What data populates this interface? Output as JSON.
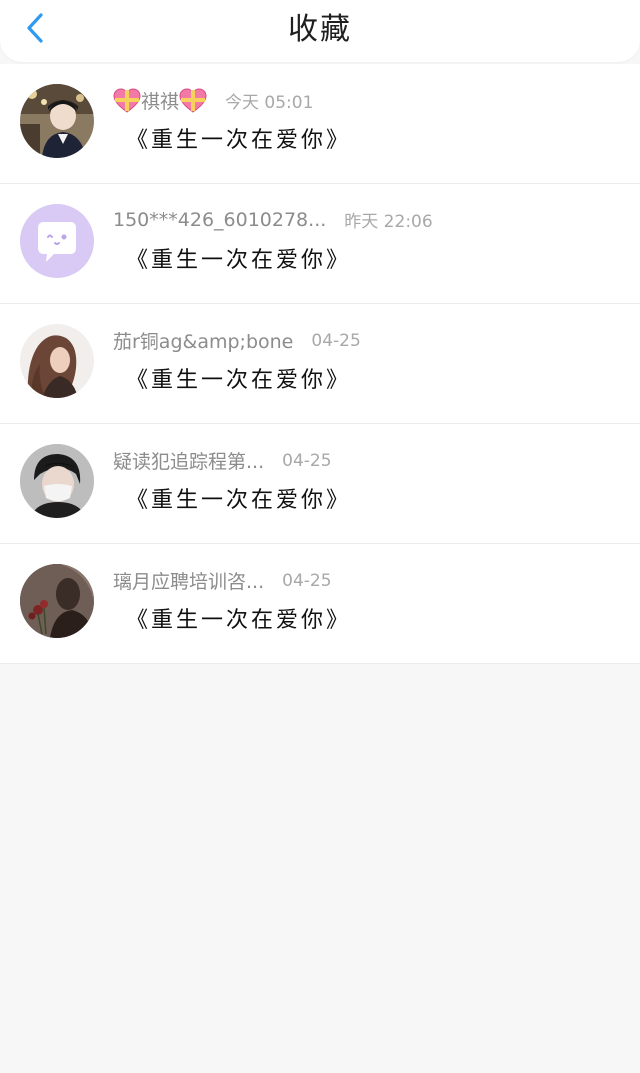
{
  "header": {
    "title": "收藏"
  },
  "items": [
    {
      "name": "祺祺",
      "time": "今天 05:01",
      "content": "《重生一次在爱你》",
      "avatar": "avatar-photo-boy"
    },
    {
      "name": "150***426_6010278...",
      "time": "昨天 22:06",
      "content": "《重生一次在爱你》",
      "avatar": "avatar-chat-bubble"
    },
    {
      "name": "茄r铜ag&amp;bone",
      "time": "04-25",
      "content": "《重生一次在爱你》",
      "avatar": "avatar-photo-girl"
    },
    {
      "name": "疑读犯追踪程第...",
      "time": "04-25",
      "content": "《重生一次在爱你》",
      "avatar": "avatar-photo-mask"
    },
    {
      "name": "璃月应聘培训咨...",
      "time": "04-25",
      "content": "《重生一次在爱你》",
      "avatar": "avatar-photo-flower"
    }
  ],
  "colors": {
    "accent": "#2f9bf0",
    "background": "#f8f7f8",
    "avatar_purple": "#d8c9f5"
  }
}
